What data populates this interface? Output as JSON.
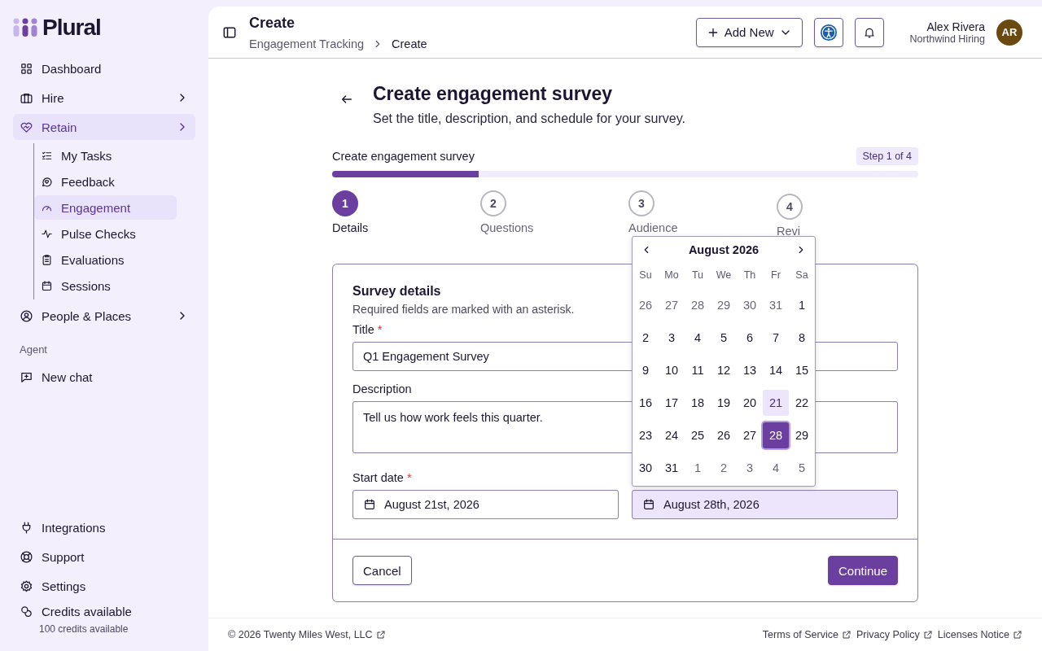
{
  "sidebar": {
    "logo": "Plural",
    "items": [
      {
        "label": "Dashboard",
        "selected": false,
        "chevron": false
      },
      {
        "label": "Hire",
        "selected": false,
        "chevron": true
      },
      {
        "label": "Retain",
        "selected": true,
        "chevron": true,
        "children": [
          {
            "label": "My Tasks",
            "selected": false
          },
          {
            "label": "Feedback",
            "selected": false
          },
          {
            "label": "Engagement",
            "selected": true
          },
          {
            "label": "Pulse Checks",
            "selected": false
          },
          {
            "label": "Evaluations",
            "selected": false
          },
          {
            "label": "Sessions",
            "selected": false
          }
        ]
      },
      {
        "label": "People & Places",
        "selected": false,
        "chevron": true
      }
    ],
    "section_label": "Agent",
    "agent_items": [
      {
        "label": "New chat",
        "selected": false
      }
    ],
    "bottom_items": [
      {
        "label": "Integrations"
      },
      {
        "label": "Support"
      },
      {
        "label": "Settings"
      }
    ],
    "credits": {
      "label": "Credits available",
      "sub": "100 credits available"
    }
  },
  "header": {
    "title": "Create",
    "breadcrumbs": [
      "Engagement Tracking",
      "Create"
    ],
    "add_button": "Add New",
    "user": {
      "name": "Alex Rivera",
      "org": "Northwind Hiring",
      "initials": "AR"
    }
  },
  "page": {
    "title": "Create engagement survey",
    "subtitle": "Set the title, description, and schedule for your survey."
  },
  "progress": {
    "label": "Create engagement survey",
    "badge": "Step 1 of 4",
    "level": 0.25
  },
  "steps": [
    {
      "number": "1",
      "label": "Details",
      "selected": true
    },
    {
      "number": "2",
      "label": "Questions",
      "selected": false
    },
    {
      "number": "3",
      "label": "Audience",
      "selected": false
    },
    {
      "number": "4",
      "label": "Revi",
      "selected": false
    }
  ],
  "form": {
    "title": "Survey details",
    "hint": "Required fields are marked with an asterisk.",
    "fields": [
      {
        "label": "Title",
        "required_mark": "*",
        "value": "Q1 Engagement Survey"
      },
      {
        "label": "Description",
        "value": "Tell us how work feels this quarter."
      }
    ],
    "start_date": {
      "label": "Start date",
      "required_mark": "*",
      "value": "August 21st, 2026"
    },
    "end_date": {
      "value": "August 28th, 2026",
      "focused": true
    },
    "cancel": "Cancel",
    "continue": "Continue"
  },
  "calendar": {
    "month": "August 2026",
    "weekdays": [
      "Su",
      "Mo",
      "Tu",
      "We",
      "Th",
      "Fr",
      "Sa"
    ],
    "days": [
      {
        "label": "26",
        "outside": true,
        "selected": false,
        "highlighted": false
      },
      {
        "label": "27",
        "outside": true,
        "selected": false,
        "highlighted": false
      },
      {
        "label": "28",
        "outside": true,
        "selected": false,
        "highlighted": false
      },
      {
        "label": "29",
        "outside": true,
        "selected": false,
        "highlighted": false
      },
      {
        "label": "30",
        "outside": true,
        "selected": false,
        "highlighted": false
      },
      {
        "label": "31",
        "outside": true,
        "selected": false,
        "highlighted": false
      },
      {
        "label": "1",
        "outside": false,
        "selected": false,
        "highlighted": false
      },
      {
        "label": "2",
        "outside": false,
        "selected": false,
        "highlighted": false
      },
      {
        "label": "3",
        "outside": false,
        "selected": false,
        "highlighted": false
      },
      {
        "label": "4",
        "outside": false,
        "selected": false,
        "highlighted": false
      },
      {
        "label": "5",
        "outside": false,
        "selected": false,
        "highlighted": false
      },
      {
        "label": "6",
        "outside": false,
        "selected": false,
        "highlighted": false
      },
      {
        "label": "7",
        "outside": false,
        "selected": false,
        "highlighted": false
      },
      {
        "label": "8",
        "outside": false,
        "selected": false,
        "highlighted": false
      },
      {
        "label": "9",
        "outside": false,
        "selected": false,
        "highlighted": false
      },
      {
        "label": "10",
        "outside": false,
        "selected": false,
        "highlighted": false
      },
      {
        "label": "11",
        "outside": false,
        "selected": false,
        "highlighted": false
      },
      {
        "label": "12",
        "outside": false,
        "selected": false,
        "highlighted": false
      },
      {
        "label": "13",
        "outside": false,
        "selected": false,
        "highlighted": false
      },
      {
        "label": "14",
        "outside": false,
        "selected": false,
        "highlighted": false
      },
      {
        "label": "15",
        "outside": false,
        "selected": false,
        "highlighted": false
      },
      {
        "label": "16",
        "outside": false,
        "selected": false,
        "highlighted": false
      },
      {
        "label": "17",
        "outside": false,
        "selected": false,
        "highlighted": false
      },
      {
        "label": "18",
        "outside": false,
        "selected": false,
        "highlighted": false
      },
      {
        "label": "19",
        "outside": false,
        "selected": false,
        "highlighted": false
      },
      {
        "label": "20",
        "outside": false,
        "selected": false,
        "highlighted": false
      },
      {
        "label": "21",
        "outside": false,
        "selected": false,
        "highlighted": true
      },
      {
        "label": "22",
        "outside": false,
        "selected": false,
        "highlighted": false
      },
      {
        "label": "23",
        "outside": false,
        "selected": false,
        "highlighted": false
      },
      {
        "label": "24",
        "outside": false,
        "selected": false,
        "highlighted": false
      },
      {
        "label": "25",
        "outside": false,
        "selected": false,
        "highlighted": false
      },
      {
        "label": "26",
        "outside": false,
        "selected": false,
        "highlighted": false
      },
      {
        "label": "27",
        "outside": false,
        "selected": false,
        "highlighted": false
      },
      {
        "label": "28",
        "outside": false,
        "selected": true,
        "highlighted": false
      },
      {
        "label": "29",
        "outside": false,
        "selected": false,
        "highlighted": false
      },
      {
        "label": "30",
        "outside": false,
        "selected": false,
        "highlighted": false
      },
      {
        "label": "31",
        "outside": false,
        "selected": false,
        "highlighted": false
      },
      {
        "label": "1",
        "outside": true,
        "selected": false,
        "highlighted": false
      },
      {
        "label": "2",
        "outside": true,
        "selected": false,
        "highlighted": false
      },
      {
        "label": "3",
        "outside": true,
        "selected": false,
        "highlighted": false
      },
      {
        "label": "4",
        "outside": true,
        "selected": false,
        "highlighted": false
      },
      {
        "label": "5",
        "outside": true,
        "selected": false,
        "highlighted": false
      }
    ]
  },
  "footer": {
    "copyright": "© 2026 Twenty Miles West, LLC",
    "links": [
      "Terms of Service",
      "Privacy Policy",
      "Licenses Notice"
    ]
  }
}
